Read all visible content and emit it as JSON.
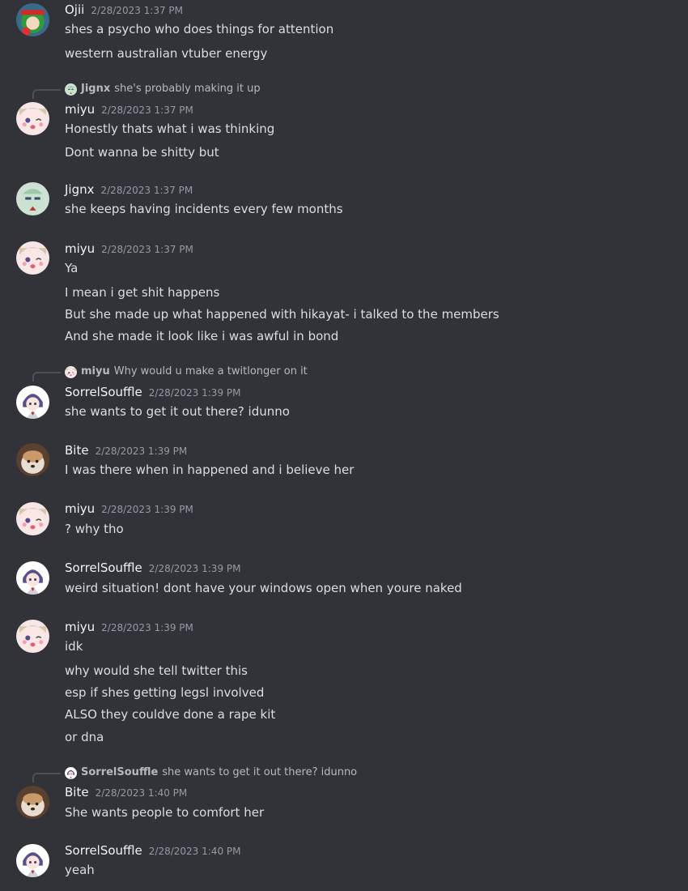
{
  "messages": [
    {
      "author": "Ojii",
      "timestamp": "2/28/2023 1:37 PM",
      "avatar": "ojii-avatar",
      "lines": [
        "shes a psycho who does things for attention",
        "western australian vtuber energy"
      ]
    },
    {
      "reply_to": {
        "author": "Jignx",
        "text": "she's probably making it up",
        "avatar": "jignx-avatar"
      },
      "author": "miyu",
      "timestamp": "2/28/2023 1:37 PM",
      "avatar": "miyu-avatar",
      "lines": [
        "Honestly thats what i was thinking",
        "Dont wanna be shitty but"
      ]
    },
    {
      "author": "Jignx",
      "timestamp": "2/28/2023 1:37 PM",
      "avatar": "jignx-avatar",
      "lines": [
        "she keeps having incidents every few months"
      ]
    },
    {
      "author": "miyu",
      "timestamp": "2/28/2023 1:37 PM",
      "avatar": "miyu-avatar",
      "lines": [
        "Ya",
        "I mean i get shit happens",
        "But she made up what happened with hikayat- i talked to the members",
        "And she made it look like i was awful in bond"
      ]
    },
    {
      "reply_to": {
        "author": "miyu",
        "text": "Why would u make a twitlonger on it",
        "avatar": "miyu-avatar"
      },
      "author": "SorrelSouffle",
      "timestamp": "2/28/2023 1:39 PM",
      "avatar": "sorrel-avatar",
      "lines": [
        "she wants to get it out there? idunno"
      ]
    },
    {
      "author": "Bite",
      "timestamp": "2/28/2023 1:39 PM",
      "avatar": "bite-avatar",
      "lines": [
        "I was there when in happened and i believe her"
      ]
    },
    {
      "author": "miyu",
      "timestamp": "2/28/2023 1:39 PM",
      "avatar": "miyu-avatar",
      "lines": [
        "? why tho"
      ]
    },
    {
      "author": "SorrelSouffle",
      "timestamp": "2/28/2023 1:39 PM",
      "avatar": "sorrel-avatar",
      "lines": [
        "weird situation! dont have your windows open when youre naked"
      ]
    },
    {
      "author": "miyu",
      "timestamp": "2/28/2023 1:39 PM",
      "avatar": "miyu-avatar",
      "lines": [
        "idk",
        "why would she tell twitter this",
        "esp if shes getting legsl involved",
        "ALSO they couldve done a rape kit",
        "or dna"
      ]
    },
    {
      "reply_to": {
        "author": "SorrelSouffle",
        "text": "she wants to get it out there? idunno",
        "avatar": "sorrel-avatar"
      },
      "author": "Bite",
      "timestamp": "2/28/2023 1:40 PM",
      "avatar": "bite-avatar",
      "lines": [
        "She wants people to comfort her"
      ]
    },
    {
      "author": "SorrelSouffle",
      "timestamp": "2/28/2023 1:40 PM",
      "avatar": "sorrel-avatar",
      "lines": [
        "yeah"
      ]
    }
  ]
}
